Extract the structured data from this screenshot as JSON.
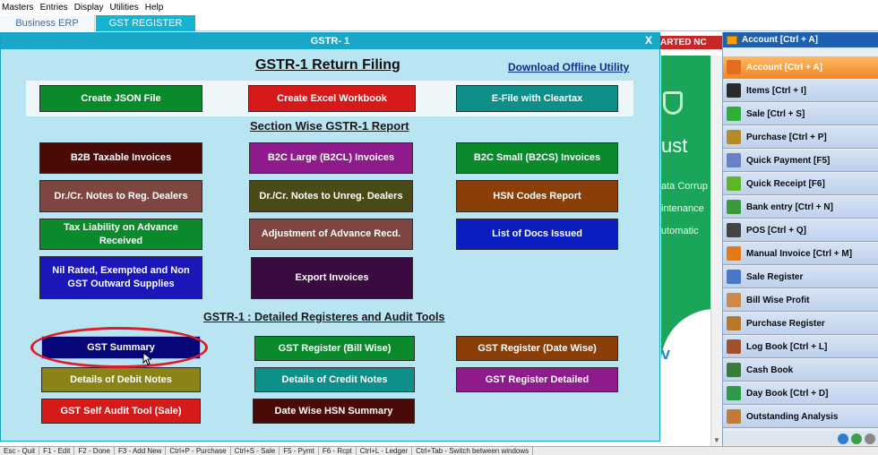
{
  "menu": [
    "Masters",
    "Entries",
    "Display",
    "Utilities",
    "Help"
  ],
  "tabs": {
    "erp": "Business ERP",
    "gst": "GST REGISTER"
  },
  "background": {
    "banner": "ARTED NC",
    "ust": "ust",
    "line1": "ata Corrup",
    "line2": "intenance",
    "line3": "utomatic",
    "v": "v"
  },
  "dialog": {
    "title": "GSTR- 1",
    "close": "X",
    "heading": "GSTR-1 Return Filing",
    "download": "Download Offline Utility",
    "section_heading": "Section Wise GSTR-1 Report",
    "detail_heading": "GSTR-1 : Detailed Registeres and Audit Tools",
    "top_buttons": {
      "json": "Create JSON File",
      "excel": "Create Excel Workbook",
      "efile": "E-File with Cleartax"
    },
    "section_buttons": {
      "b2b": "B2B Taxable Invoices",
      "b2cl": "B2C Large (B2CL) Invoices",
      "b2cs": "B2C Small (B2CS) Invoices",
      "drcr_reg": "Dr./Cr. Notes to Reg. Dealers",
      "drcr_unreg": "Dr./Cr. Notes to Unreg. Dealers",
      "hsn": "HSN Codes Report",
      "tax_liability": "Tax Liability on Advance Received",
      "adjustment": "Adjustment of Advance Recd.",
      "docs": "List of Docs Issued",
      "nil_rated": "Nil Rated, Exempted and Non GST Outward Supplies",
      "export": "Export Invoices"
    },
    "detail_buttons": {
      "gst_summary": "GST Summary",
      "gst_bill": "GST Register (Bill Wise)",
      "gst_date": "GST Register (Date Wise)",
      "debit_notes": "Details of Debit Notes",
      "credit_notes": "Details of Credit Notes",
      "gst_detailed": "GST Register Detailed",
      "self_audit": "GST Self Audit Tool (Sale)",
      "hsn_summary": "Date Wise HSN Summary"
    }
  },
  "right_panel": {
    "header": "Account [Ctrl + A]",
    "items": [
      "Account [Ctrl + A]",
      "Items [Ctrl + I]",
      "Sale [Ctrl + S]",
      "Purchase [Ctrl + P]",
      "Quick Payment [F5]",
      "Quick Receipt [F6]",
      "Bank entry [Ctrl + N]",
      "POS [Ctrl + Q]",
      "Manual Invoice [Ctrl + M]",
      "Sale Register",
      "Bill Wise Profit",
      "Purchase Register",
      "Log Book [Ctrl + L]",
      "Cash Book",
      "Day Book [Ctrl + D]",
      "Outstanding Analysis"
    ]
  },
  "status": [
    "Esc - Quit",
    "F1 - Edit",
    "F2 - Done",
    "F3 - Add New",
    "Ctrl+P - Purchase",
    "Ctrl+S - Sale",
    "F5 - Pymt",
    "F6 - Rcpt",
    "Ctrl+L - Ledger",
    "Ctrl+Tab - Switch between windows"
  ],
  "colors": {
    "dialog_bg": "#b9e4f2",
    "title_bar": "#19a7c9",
    "highlight_oval": "#e01b24"
  }
}
